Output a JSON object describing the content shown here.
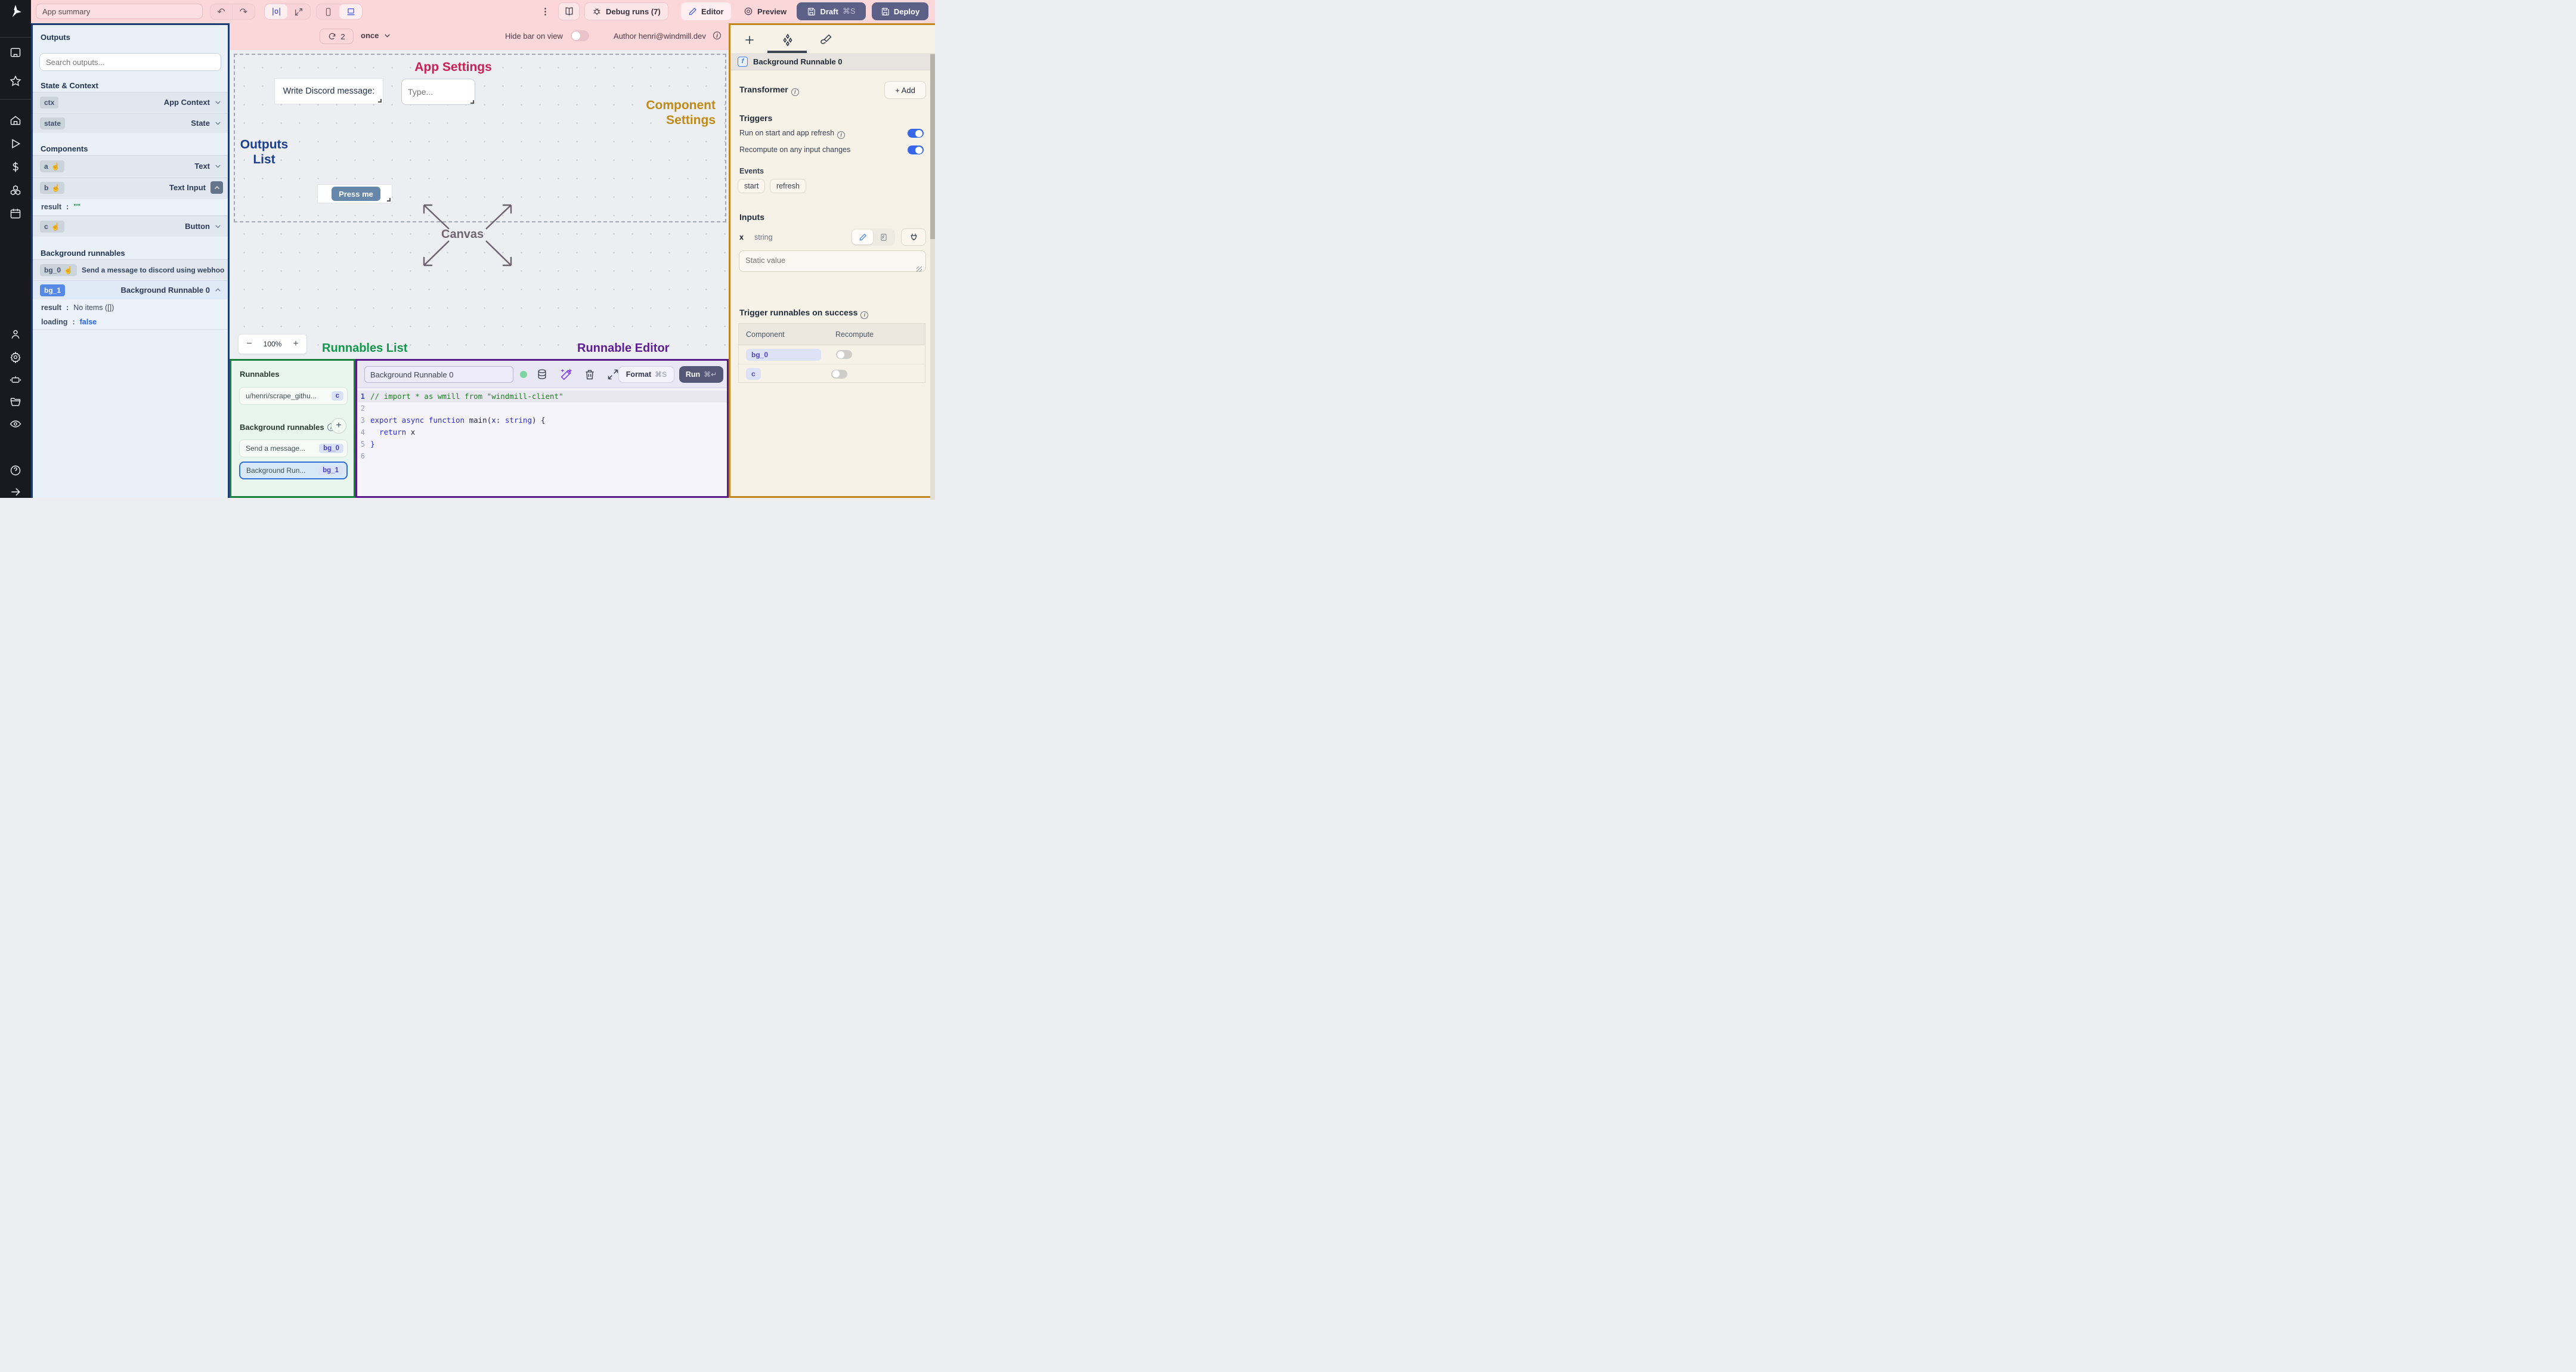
{
  "toolbar": {
    "app_summary_value": "App summary",
    "undo_glyph": "↶",
    "redo_glyph": "↷",
    "kebab_glyph": "⋮",
    "debug_runs_label": "Debug runs (7)",
    "editor_label": "Editor",
    "preview_label": "Preview",
    "draft_label": "Draft",
    "draft_kbd": "⌘S",
    "deploy_label": "Deploy"
  },
  "canvas_bar": {
    "refresh_count": "2",
    "schedule_value": "once",
    "hide_bar_label": "Hide bar on view",
    "author_label": "Author henri@windmill.dev"
  },
  "outputs": {
    "title": "Outputs",
    "search_placeholder": "Search outputs...",
    "state_context_title": "State & Context",
    "rows_state": [
      {
        "key": "ctx",
        "type": "App Context"
      },
      {
        "key": "state",
        "type": "State"
      }
    ],
    "components_title": "Components",
    "rows_components": [
      {
        "key": "a",
        "type": "Text"
      },
      {
        "key": "b",
        "type": "Text Input"
      },
      {
        "key": "c",
        "type": "Button"
      }
    ],
    "b_result": {
      "key": "result",
      "colon": ":",
      "value": "\"\""
    },
    "bg_title": "Background runnables",
    "bg0": {
      "key": "bg_0",
      "label": "Send a message to discord using webhoo"
    },
    "bg1": {
      "key": "bg_1",
      "label": "Background Runnable 0"
    },
    "bg1_result": {
      "key": "result",
      "colon": ":",
      "value": "No items ([])"
    },
    "bg1_loading": {
      "key": "loading",
      "colon": ":",
      "value": "false"
    }
  },
  "canvas": {
    "annotations": {
      "app_settings": "App Settings",
      "component_settings": "Component Settings",
      "outputs_list": "Outputs List",
      "canvas": "Canvas",
      "runnables_list": "Runnables List",
      "runnable_editor": "Runnable Editor"
    },
    "discord_label": "Write Discord message:",
    "type_placeholder": "Type...",
    "press_me_label": "Press me",
    "zoom": {
      "minus": "−",
      "value": "100%",
      "plus": "+"
    }
  },
  "runnables_panel": {
    "title": "Runnables",
    "item_script": {
      "label": "u/henri/scrape_githu...",
      "badge": "c"
    },
    "bg_section_title": "Background runnables",
    "item_bg0": {
      "label": "Send a message...",
      "badge": "bg_0"
    },
    "item_bg1": {
      "label": "Background Run...",
      "badge": "bg_1"
    }
  },
  "editor": {
    "name_value": "Background Runnable 0",
    "format_label": "Format",
    "format_kbd": "⌘S",
    "run_label": "Run",
    "run_kbd": "⌘↵",
    "line_numbers": [
      "1",
      "2",
      "3",
      "4",
      "5",
      "6"
    ],
    "code": {
      "l1": "// import * as wmill from \"windmill-client\"",
      "l3_kw": "export async function",
      "l3_id": " main",
      "l3_p1": "(",
      "l3_param": "x",
      "l3_p2": ": ",
      "l3_type": "string",
      "l3_p3": ") {",
      "l4_kw": "  return",
      "l4_id": " x",
      "l5": "}"
    }
  },
  "right_panel": {
    "component_title": "Background Runnable 0",
    "f_glyph": "f",
    "transformer_title": "Transformer",
    "add_label": "+ Add",
    "triggers_title": "Triggers",
    "trigger_row1": "Run on start and app refresh",
    "trigger_row2": "Recompute on any input changes",
    "events_title": "Events",
    "chips": [
      "start",
      "refresh"
    ],
    "inputs_title": "Inputs",
    "input_name": "x",
    "input_type": "string",
    "static_placeholder": "Static value",
    "success_title": "Trigger runnables on success",
    "table": {
      "col1": "Component",
      "col2": "Recompute",
      "rows": [
        {
          "badge": "bg_0"
        },
        {
          "badge": "c"
        }
      ]
    }
  }
}
